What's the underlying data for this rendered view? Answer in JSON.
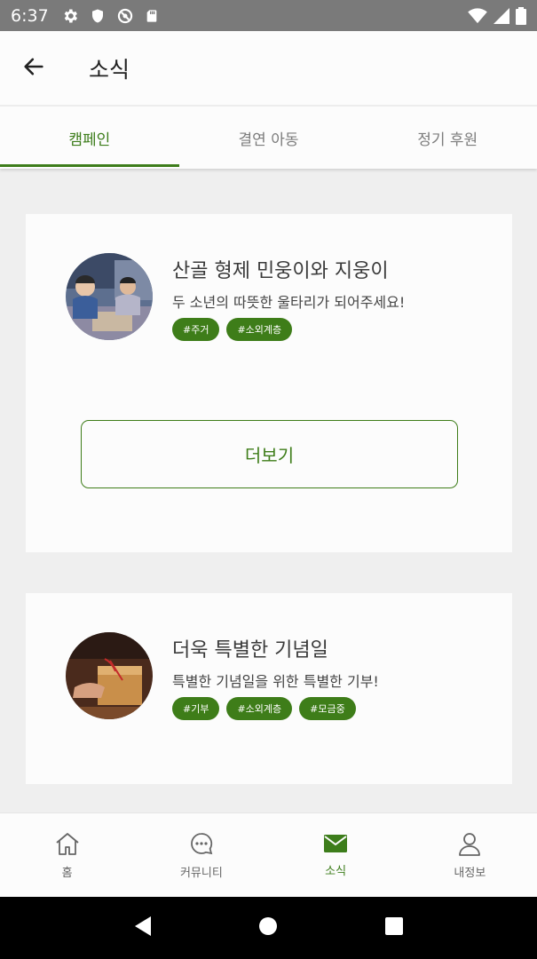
{
  "status_bar": {
    "time": "6:37",
    "icons": [
      "settings-icon",
      "shield-icon",
      "sync-icon",
      "sd-card-icon",
      "wifi-icon",
      "signal-icon",
      "battery-icon"
    ]
  },
  "header": {
    "back_icon": "arrow-left-icon",
    "title": "소식"
  },
  "tabs": [
    {
      "label": "캠페인",
      "active": true
    },
    {
      "label": "결연 아동",
      "active": false
    },
    {
      "label": "정기 후원",
      "active": false
    }
  ],
  "cards": [
    {
      "title": "산골 형제 민웅이와 지웅이",
      "subtitle": "두 소년의 따뜻한 울타리가 되어주세요!",
      "tags": [
        "#주거",
        "#소외계층"
      ],
      "more_label": "더보기"
    },
    {
      "title": "더욱 특별한 기념일",
      "subtitle": "특별한 기념일을 위한 특별한 기부!",
      "tags": [
        "#기부",
        "#소외계층",
        "#모금중"
      ]
    }
  ],
  "bottom_nav": [
    {
      "label": "홈",
      "icon": "home-icon",
      "active": false
    },
    {
      "label": "커뮤니티",
      "icon": "chat-icon",
      "active": false
    },
    {
      "label": "소식",
      "icon": "mail-icon",
      "active": true
    },
    {
      "label": "내정보",
      "icon": "person-icon",
      "active": false
    }
  ],
  "colors": {
    "accent": "#3e7d19",
    "status_bar": "#7a7a7a",
    "background": "#efefef",
    "surface": "#fcfcfc"
  }
}
